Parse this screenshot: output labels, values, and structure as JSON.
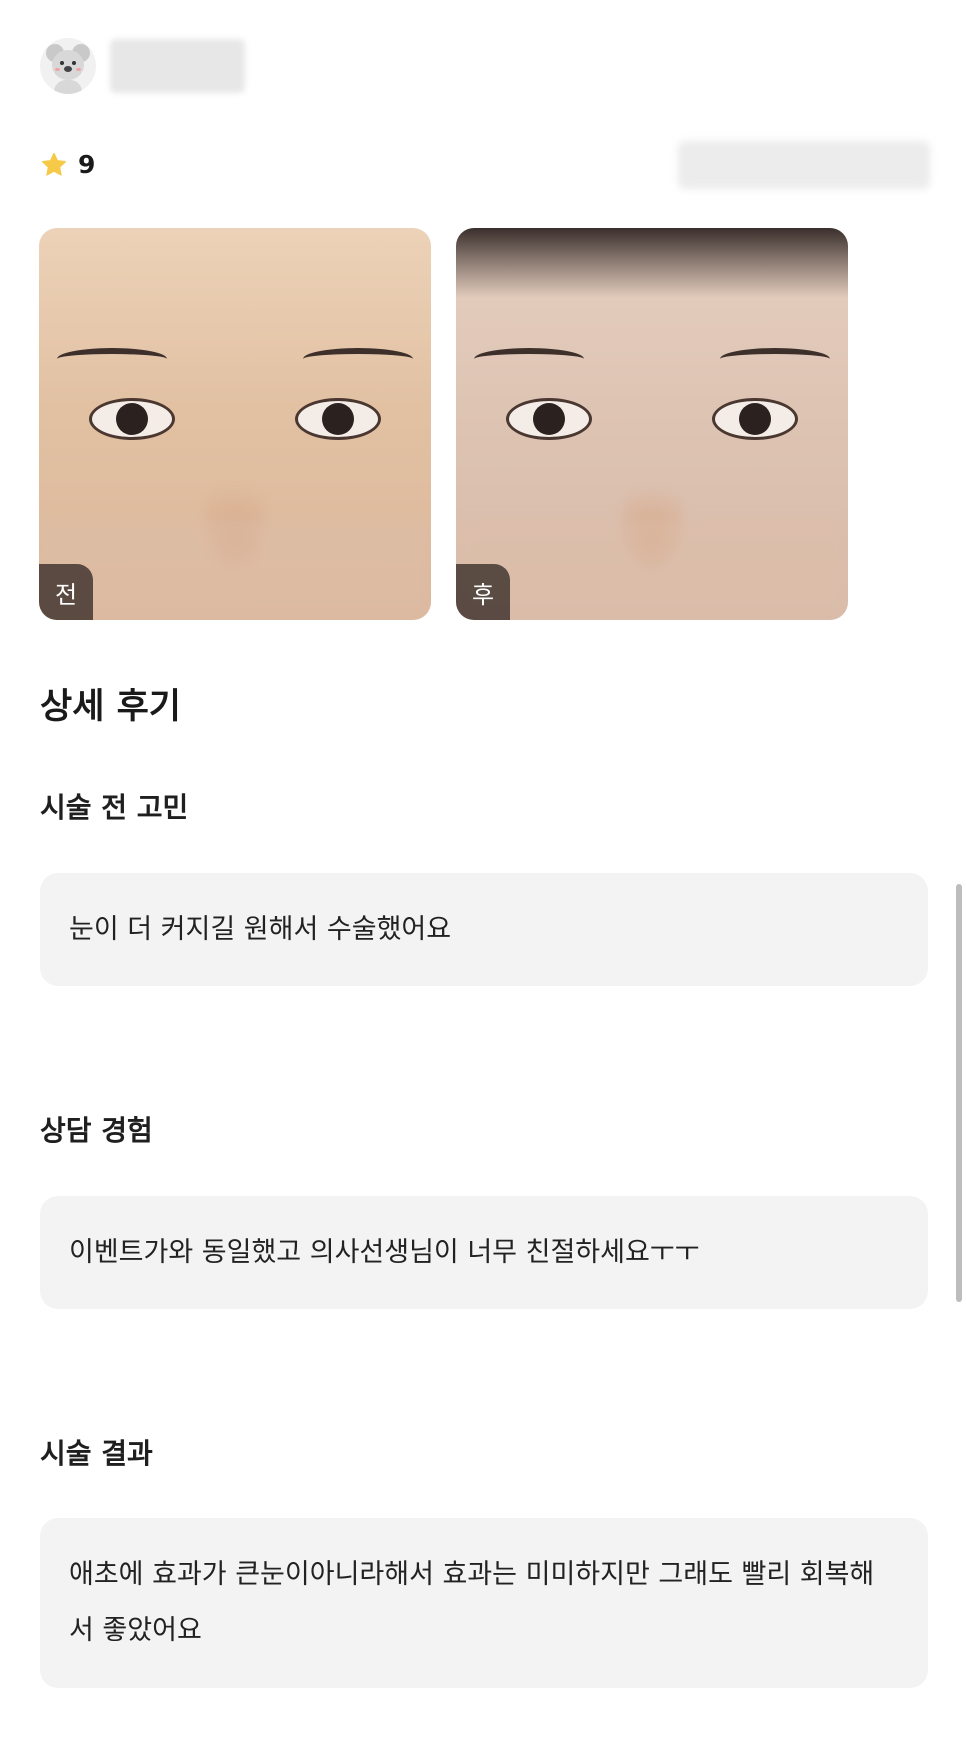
{
  "review": {
    "rating": "9",
    "photos": [
      {
        "label": "전"
      },
      {
        "label": "후"
      }
    ],
    "section_title": "상세 후기",
    "questions": [
      {
        "label": "시술 전 고민",
        "answer": "눈이 더 커지길 원해서 수술했어요"
      },
      {
        "label": "상담 경험",
        "answer": "이벤트가와 동일했고 의사선생님이 너무 친절하세요ㅜㅜ"
      },
      {
        "label": "시술 결과",
        "answer": "애초에 효과가 큰눈이아니라해서 효과는 미미하지만 그래도 빨리 회복해서 좋았어요"
      }
    ]
  },
  "icons": {
    "avatar": "koala-avatar-icon",
    "rating": "star-icon"
  },
  "colors": {
    "star": "#F7C948",
    "answer_bg": "#F3F3F3",
    "badge_bg": "#281E1C"
  }
}
